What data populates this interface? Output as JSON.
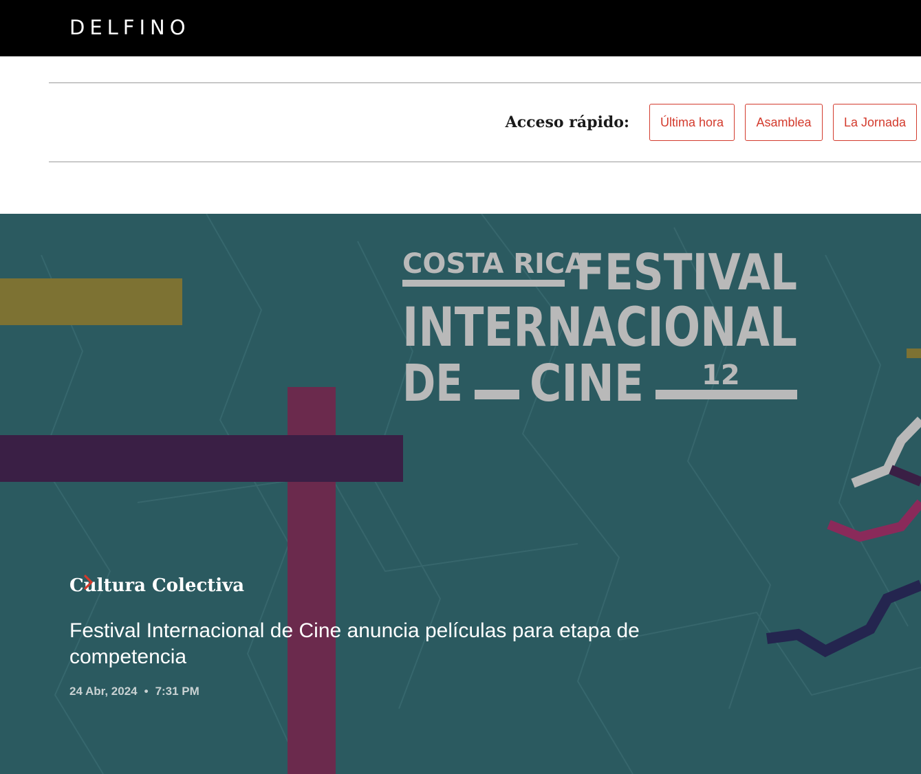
{
  "header": {
    "logo": "DELFINO"
  },
  "quick_access": {
    "label": "Acceso rápido:",
    "buttons": [
      {
        "label": "Última hora"
      },
      {
        "label": "Asamblea"
      },
      {
        "label": "La Jornada"
      }
    ]
  },
  "hero": {
    "image_text": {
      "line1_small": "COSTA RICA",
      "line1_big": "FESTIVAL",
      "line2": "INTERNACIONAL",
      "line3_a": "DE",
      "line3_b": "CINE",
      "edition": "12"
    },
    "category": "Cultura Colectiva",
    "headline": "Festival Internacional de Cine anuncia películas para etapa de competencia",
    "date": "24 Abr, 2024",
    "separator": "•",
    "time": "7:31 PM"
  },
  "colors": {
    "accent": "#d33a2c",
    "hero_bg": "#2b5a60",
    "mustard": "#7d7233",
    "purple": "#3a1f45",
    "magenta": "#6b2a4d"
  }
}
